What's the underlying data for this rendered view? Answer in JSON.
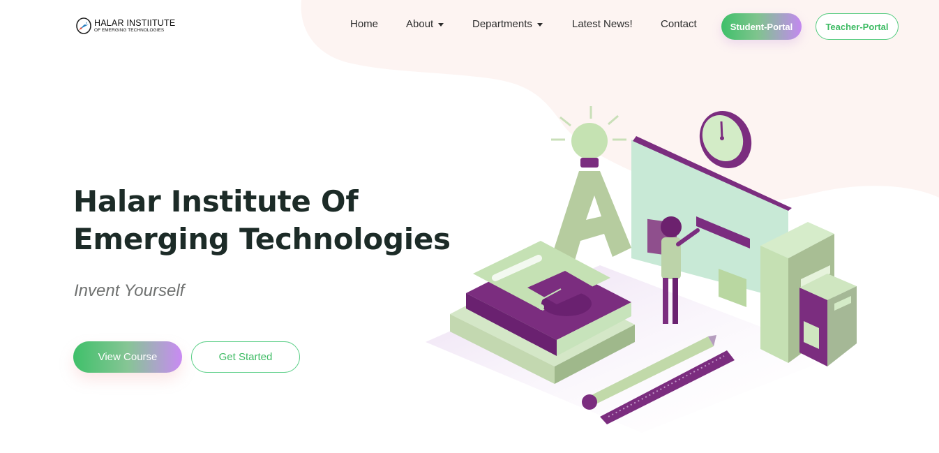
{
  "brand": {
    "title": "HALAR INSTIITUTE",
    "subtitle": "OF EMERGING TECHNOLOGIES"
  },
  "nav": {
    "home": "Home",
    "about": "About",
    "departments": "Departments",
    "news": "Latest News!",
    "contact": "Contact",
    "student_portal": "Student-Portal",
    "teacher_portal": "Teacher-Portal"
  },
  "hero": {
    "title_line1": "Halar Institute Of",
    "title_line2": "Emerging Technologies",
    "tagline": "Invent Yourself",
    "view_course": "View Course",
    "get_started": "Get Started"
  },
  "colors": {
    "accent_green": "#3dbb63",
    "accent_purple": "#c98af3",
    "illustration_purple": "#7b2d7f",
    "illustration_green": "#bfe3b2",
    "background_blob": "#fdf3f1",
    "heading": "#1c2b27"
  },
  "icons": {
    "logo": "rocket-orbit-logo-icon",
    "dropdown": "caret-down-icon"
  }
}
